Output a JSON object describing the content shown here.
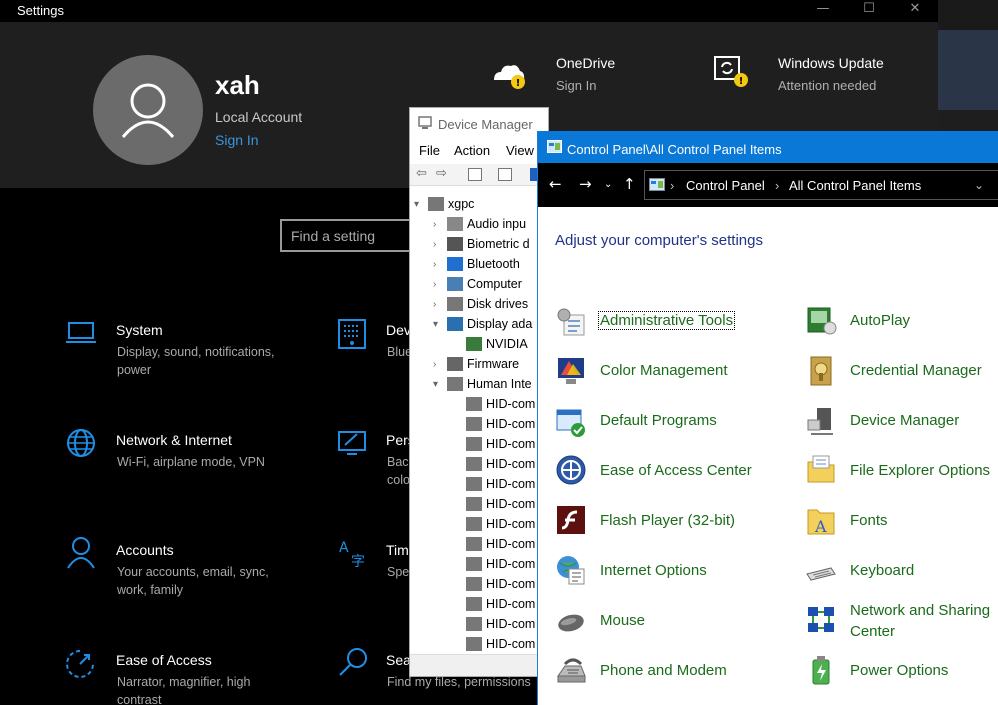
{
  "settings": {
    "window_title": "Settings",
    "window_controls": [
      "—",
      "☐",
      "✕"
    ],
    "profile": {
      "username": "xah",
      "account_type": "Local Account",
      "sign_in": "Sign In"
    },
    "onedrive": {
      "title": "OneDrive",
      "subtitle": "Sign In"
    },
    "windows_update": {
      "title": "Windows Update",
      "subtitle": "Attention needed"
    },
    "search": {
      "placeholder": "Find a setting"
    },
    "categories": [
      {
        "title": "System",
        "desc": "Display, sound, notifications, power",
        "icon": "laptop-icon"
      },
      {
        "title": "Network & Internet",
        "desc": "Wi-Fi, airplane mode, VPN",
        "icon": "globe-icon"
      },
      {
        "title": "Accounts",
        "desc": "Your accounts, email, sync, work, family",
        "icon": "person-icon"
      },
      {
        "title": "Ease of Access",
        "desc": "Narrator, magnifier, high contrast",
        "icon": "ease-of-access-icon"
      },
      {
        "title": "Dev",
        "desc": "Blue",
        "icon": "keyboard-icon"
      },
      {
        "title": "Pers",
        "desc": "Back colo",
        "icon": "paint-icon"
      },
      {
        "title": "Tim",
        "desc": "Spe",
        "icon": "language-icon"
      },
      {
        "title": "Sea",
        "desc": "Find my files, permissions",
        "icon": "search-icon"
      }
    ],
    "accent_color": "#0078d7"
  },
  "device_manager": {
    "window_title": "Device Manager",
    "menu": [
      "File",
      "Action",
      "View"
    ],
    "tree": [
      {
        "label": "xgpc",
        "expand": "▾"
      },
      {
        "label": "Audio inpu",
        "expand": "›"
      },
      {
        "label": "Biometric d",
        "expand": "›"
      },
      {
        "label": "Bluetooth",
        "expand": "›"
      },
      {
        "label": "Computer",
        "expand": "›"
      },
      {
        "label": "Disk drives",
        "expand": "›"
      },
      {
        "label": "Display ada",
        "expand": "▾"
      },
      {
        "label": "NVIDIA",
        "expand": ""
      },
      {
        "label": "Firmware",
        "expand": "›"
      },
      {
        "label": "Human Inte",
        "expand": "▾"
      },
      {
        "label": "HID-com",
        "expand": ""
      },
      {
        "label": "HID-com",
        "expand": ""
      },
      {
        "label": "HID-com",
        "expand": ""
      },
      {
        "label": "HID-com",
        "expand": ""
      },
      {
        "label": "HID-com",
        "expand": ""
      },
      {
        "label": "HID-com",
        "expand": ""
      },
      {
        "label": "HID-com",
        "expand": ""
      },
      {
        "label": "HID-com",
        "expand": ""
      },
      {
        "label": "HID-com",
        "expand": ""
      },
      {
        "label": "HID-com",
        "expand": ""
      },
      {
        "label": "HID-com",
        "expand": ""
      },
      {
        "label": "HID-com",
        "expand": ""
      },
      {
        "label": "HID-com",
        "expand": ""
      }
    ]
  },
  "control_panel": {
    "window_title": "Control Panel\\All Control Panel Items",
    "breadcrumb": [
      "Control Panel",
      "All Control Panel Items"
    ],
    "heading": "Adjust your computer's settings",
    "items_left": [
      "Administrative Tools",
      "Color Management",
      "Default Programs",
      "Ease of Access Center",
      "Flash Player (32-bit)",
      "Internet Options",
      "Mouse",
      "Phone and Modem"
    ],
    "items_right": [
      "AutoPlay",
      "Credential Manager",
      "Device Manager",
      "File Explorer Options",
      "Fonts",
      "Keyboard",
      "Network and Sharing",
      "Power Options"
    ],
    "items_right_extra": "Center",
    "link_color": "#1a6b1a"
  }
}
